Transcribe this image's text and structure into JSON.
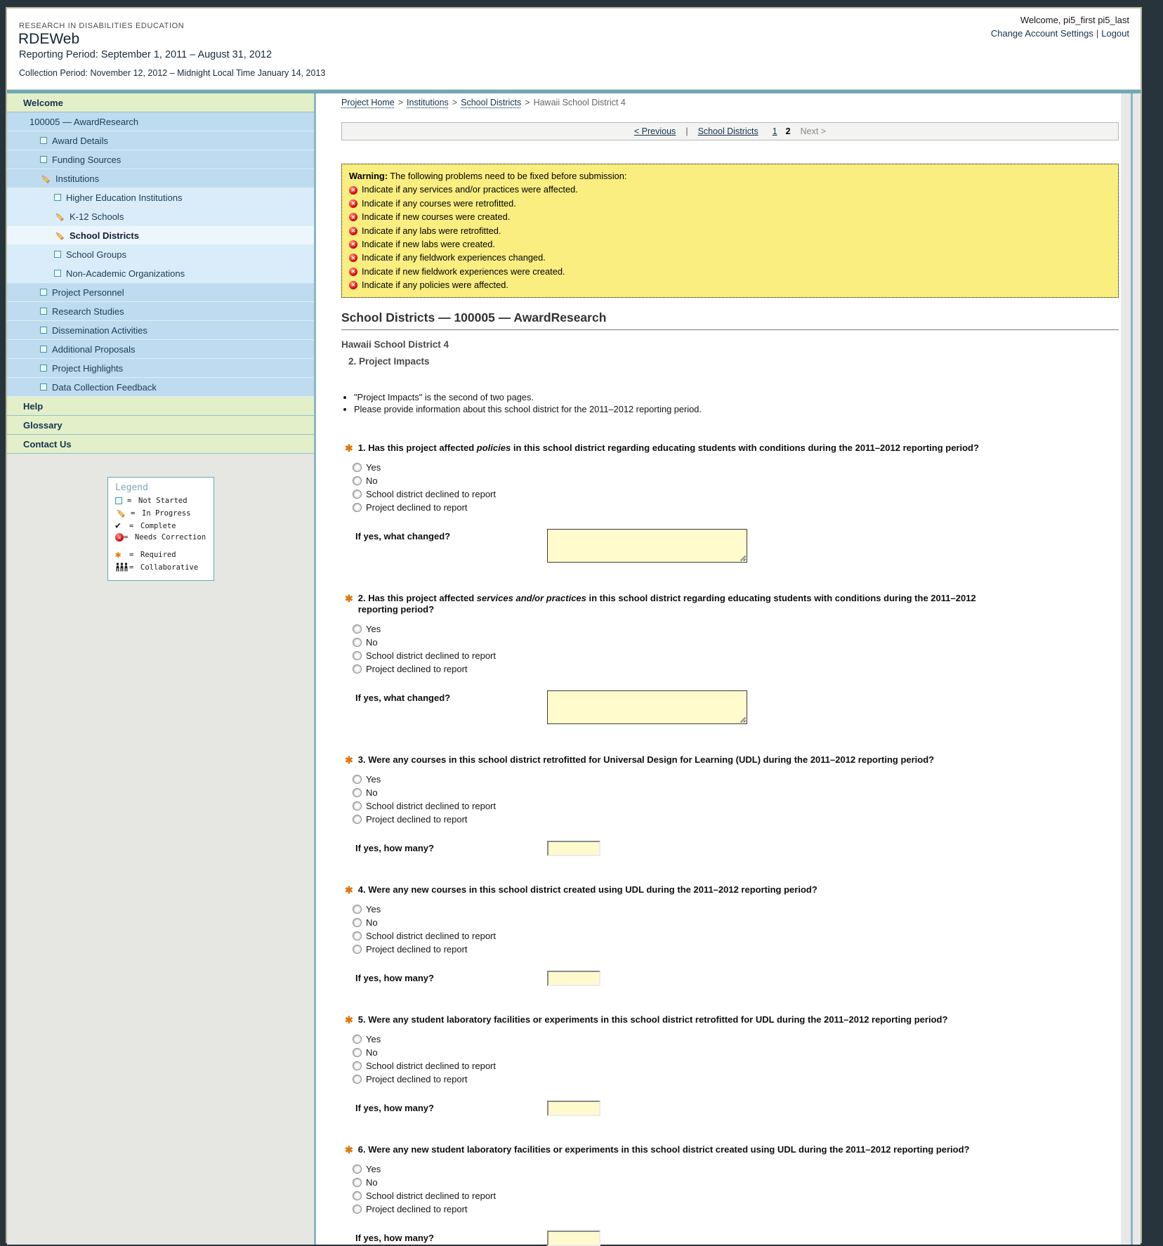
{
  "header": {
    "org": "RESEARCH IN DISABILITIES EDUCATION",
    "app": "RDEWeb",
    "reporting_period": "Reporting Period: September 1, 2011 – August 31, 2012",
    "collection_period": "Collection Period: November 12, 2012 – Midnight Local Time January 14, 2013",
    "welcome": "Welcome, pi5_first pi5_last",
    "change_account": "Change Account Settings",
    "logout": "Logout",
    "link_separator": "|"
  },
  "sidebar": {
    "items": [
      {
        "label": "Welcome",
        "type": "section",
        "icon": null,
        "selected": false
      },
      {
        "label": "100005 — AwardResearch",
        "type": "award",
        "icon": null,
        "selected": false
      },
      {
        "label": "Award Details",
        "type": "item",
        "icon": "square",
        "selected": false
      },
      {
        "label": "Funding Sources",
        "type": "item",
        "icon": "square",
        "selected": false
      },
      {
        "label": "Institutions",
        "type": "item",
        "icon": "pencil",
        "selected": false
      },
      {
        "label": "Higher Education Institutions",
        "type": "sub",
        "icon": "square",
        "selected": false
      },
      {
        "label": "K-12 Schools",
        "type": "sub",
        "icon": "pencil",
        "selected": false
      },
      {
        "label": "School Districts",
        "type": "sub",
        "icon": "pencil",
        "selected": true
      },
      {
        "label": "School Groups",
        "type": "sub",
        "icon": "square",
        "selected": false
      },
      {
        "label": "Non-Academic Organizations",
        "type": "sub",
        "icon": "square",
        "selected": false
      },
      {
        "label": "Project Personnel",
        "type": "item",
        "icon": "square",
        "selected": false
      },
      {
        "label": "Research Studies",
        "type": "item",
        "icon": "square",
        "selected": false
      },
      {
        "label": "Dissemination Activities",
        "type": "item",
        "icon": "square",
        "selected": false
      },
      {
        "label": "Additional Proposals",
        "type": "item",
        "icon": "square",
        "selected": false
      },
      {
        "label": "Project Highlights",
        "type": "item",
        "icon": "square",
        "selected": false
      },
      {
        "label": "Data Collection Feedback",
        "type": "item",
        "icon": "square",
        "selected": false
      },
      {
        "label": "Help",
        "type": "section",
        "icon": null,
        "selected": false
      },
      {
        "label": "Glossary",
        "type": "section",
        "icon": null,
        "selected": false
      },
      {
        "label": "Contact Us",
        "type": "section",
        "icon": null,
        "selected": false
      }
    ]
  },
  "legend": {
    "title": "Legend",
    "equals": "=",
    "items": [
      {
        "icon": "square",
        "label": "Not Started"
      },
      {
        "icon": "pencil",
        "label": "In Progress"
      },
      {
        "icon": "check",
        "label": "Complete"
      },
      {
        "icon": "error",
        "label": "Needs Correction"
      },
      {
        "icon": "asterisk",
        "label": "Required",
        "gap": true
      },
      {
        "icon": "people",
        "label": "Collaborative"
      }
    ]
  },
  "breadcrumb": {
    "separator": ">",
    "items": [
      {
        "label": "Project Home",
        "link": true
      },
      {
        "label": "Institutions",
        "link": true
      },
      {
        "label": "School Districts",
        "link": true
      },
      {
        "label": "Hawaii School District 4",
        "link": false
      }
    ]
  },
  "pagination": {
    "prev": "< Previous",
    "separator": "|",
    "group": "School Districts",
    "pages": [
      {
        "label": "1",
        "current": false
      },
      {
        "label": "2",
        "current": true
      }
    ],
    "next": "Next >"
  },
  "warning": {
    "title": "Warning:",
    "intro": " The following problems need to be fixed before submission:",
    "items": [
      "Indicate if any services and/or practices were affected.",
      "Indicate if any courses were retrofitted.",
      "Indicate if new courses were created.",
      "Indicate if any labs were retrofitted.",
      "Indicate if new labs were created.",
      "Indicate if any fieldwork experiences changed.",
      "Indicate if new fieldwork experiences were created.",
      "Indicate if any policies were affected."
    ]
  },
  "main": {
    "section_title": "School Districts — 100005 — AwardResearch",
    "district_title": "Hawaii School District 4",
    "page_title": "2. Project Impacts",
    "notes": [
      "\"Project Impacts\" is the second of two pages.",
      "Please provide information about this school district for the 2011–2012 reporting period."
    ],
    "option_labels": [
      "Yes",
      "No",
      "School district declined to report",
      "Project declined to report"
    ],
    "questions": [
      {
        "parts": [
          {
            "text": "1. Has this project affected "
          },
          {
            "text": "policies",
            "italic": true
          },
          {
            "text": " in this school district regarding educating students with conditions during the 2011–2012 reporting period?"
          }
        ],
        "followup": {
          "label": "If yes, what changed?",
          "kind": "textarea",
          "value": ""
        }
      },
      {
        "parts": [
          {
            "text": "2. Has this project affected "
          },
          {
            "text": "services and/or practices",
            "italic": true
          },
          {
            "text": " in this school district regarding educating students with conditions during the 2011–2012 reporting period?"
          }
        ],
        "followup": {
          "label": "If yes, what changed?",
          "kind": "textarea",
          "value": ""
        }
      },
      {
        "parts": [
          {
            "text": "3. Were any courses in this school district retrofitted for Universal Design for Learning (UDL) during the 2011–2012 reporting period?"
          }
        ],
        "followup": {
          "label": "If yes, how many?",
          "kind": "input",
          "value": ""
        }
      },
      {
        "parts": [
          {
            "text": "4. Were any new courses in this school district created using UDL during the 2011–2012 reporting period?"
          }
        ],
        "followup": {
          "label": "If yes, how many?",
          "kind": "input",
          "value": ""
        }
      },
      {
        "parts": [
          {
            "text": "5. Were any student laboratory facilities or experiments in this school district retrofitted for UDL during the 2011–2012 reporting period?"
          }
        ],
        "followup": {
          "label": "If yes, how many?",
          "kind": "input",
          "value": ""
        }
      },
      {
        "parts": [
          {
            "text": "6. Were any new student laboratory facilities or experiments in this school district created using UDL during the 2011–2012 reporting period?"
          }
        ],
        "followup": {
          "label": "If yes, how many?",
          "kind": "input",
          "value": ""
        }
      }
    ]
  },
  "colors": {
    "outer_background": "#28343B",
    "page_border": "#B5B59B",
    "teal_accent": "#6FA9B3",
    "sidebar_green": "#E2EFC9",
    "sidebar_blue": "#BEDBEF",
    "sidebar_light_blue": "#D9ECF9",
    "sidebar_selected": "#EDF6FD",
    "link_navy": "#16324E",
    "warning_background": "#FAEE81",
    "field_yellow": "#FFFBCC",
    "required_orange": "#E0760C",
    "error_red": "#CC0000"
  }
}
